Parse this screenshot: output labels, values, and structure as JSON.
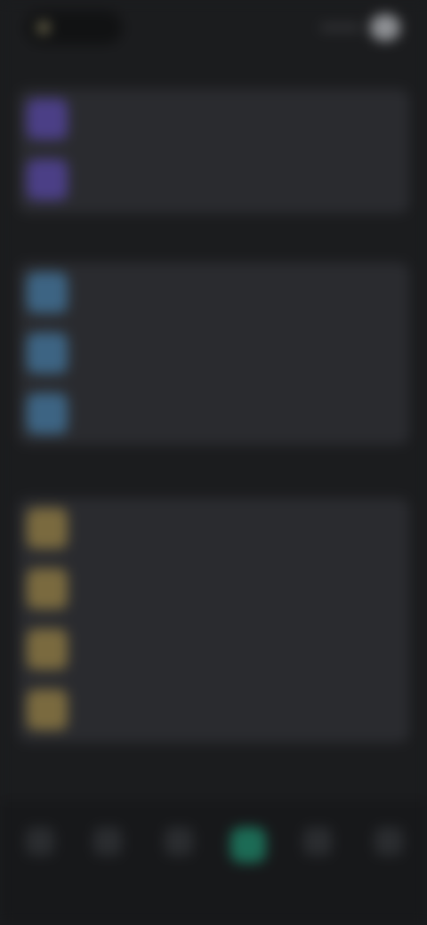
{
  "top_bar": {
    "back_label": "",
    "actions_label": ""
  },
  "sections": [
    {
      "title": "",
      "items": [
        {
          "label": "",
          "icon": "circle-icon"
        },
        {
          "label": "",
          "icon": "circle-icon"
        }
      ]
    },
    {
      "title": "",
      "items": [
        {
          "label": "",
          "icon": "circle-icon"
        },
        {
          "label": "",
          "icon": "circle-icon"
        },
        {
          "label": "",
          "icon": "circle-icon"
        }
      ]
    },
    {
      "title": "",
      "items": [
        {
          "label": "",
          "icon": "circle-icon"
        },
        {
          "label": "",
          "icon": "circle-icon"
        },
        {
          "label": "",
          "icon": "circle-icon"
        },
        {
          "label": "",
          "icon": "circle-icon"
        }
      ]
    }
  ],
  "bottom_nav": {
    "items": [
      {
        "label": "",
        "icon": "nav-icon"
      },
      {
        "label": "",
        "icon": "nav-icon"
      },
      {
        "label": "",
        "icon": "nav-icon"
      },
      {
        "label": "",
        "icon": "nav-icon"
      },
      {
        "label": "",
        "icon": "nav-icon"
      },
      {
        "label": "",
        "icon": "nav-icon"
      }
    ]
  },
  "colors": {
    "background": "#1b1c1e",
    "card": "#2a2b2f",
    "accent_purple": "#4b3f86",
    "accent_blue": "#3d6483",
    "accent_gold": "#7a6a3f",
    "active_nav": "#1c6b55"
  }
}
